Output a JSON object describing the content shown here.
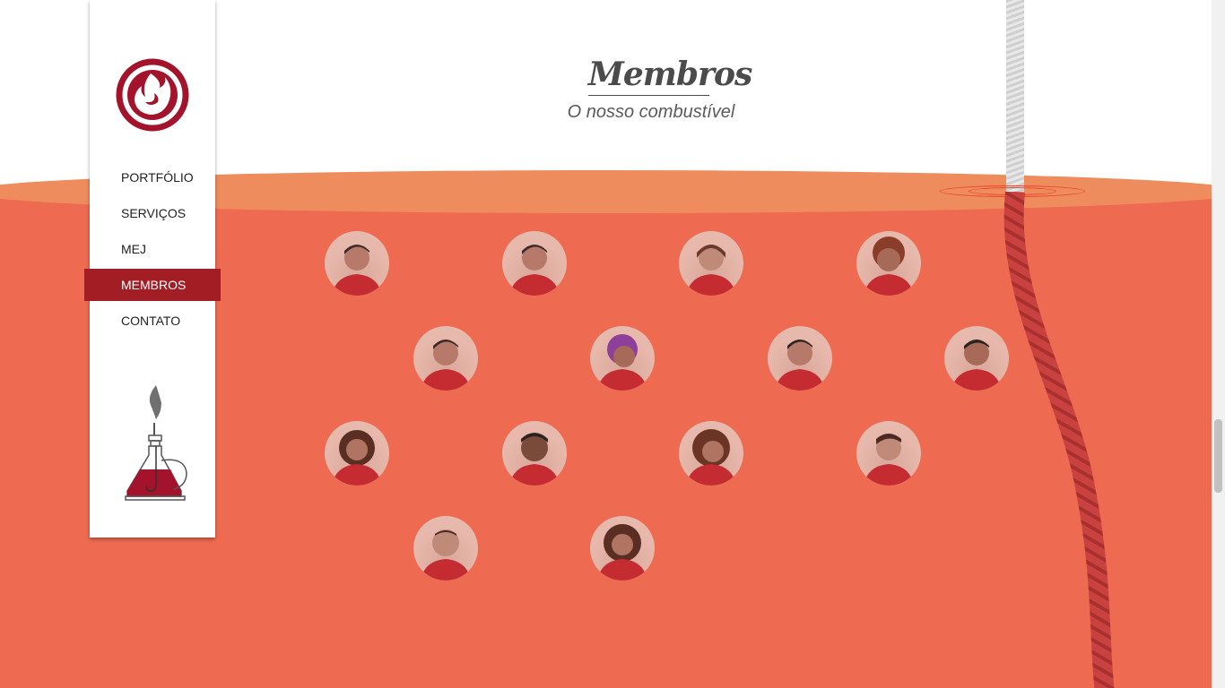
{
  "header": {
    "title": "Membros",
    "subtitle": "O nosso combustível"
  },
  "nav": {
    "items": [
      {
        "label": "PORTFÓLIO"
      },
      {
        "label": "SERVIÇOS"
      },
      {
        "label": "MEJ"
      },
      {
        "label": "MEMBROS"
      },
      {
        "label": "CONTATO"
      }
    ],
    "active": "MEMBROS"
  },
  "icons": {
    "logo": "flame-logo-icon",
    "burner": "alcohol-burner-icon"
  },
  "members_count": 14,
  "colors": {
    "accent": "#a31d25",
    "liquid": "#ee6b52",
    "liquid_surface": "#ef8c5e"
  }
}
